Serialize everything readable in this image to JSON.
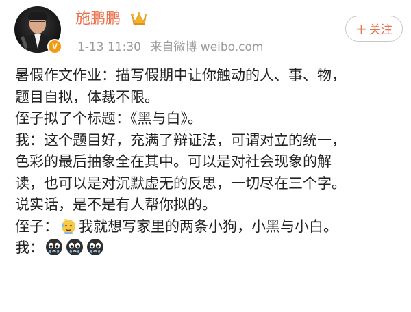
{
  "header": {
    "user_name": "施鹏鹏",
    "timestamp": "1-13 11:30",
    "source": "来自微博 weibo.com",
    "follow_label": "关注",
    "follow_plus": "+",
    "verified_badge": "V",
    "icons": {
      "vip": "crown-icon",
      "verified": "verified-v-icon"
    }
  },
  "post": {
    "lines": [
      "暑假作文作业：描写假期中让你触动的人、事、物，",
      "题目自拟，体裁不限。",
      "侄子拟了个标题：《黑与白》。",
      "我：这个题目好，充满了辩证法，可谓对立的统一，",
      "色彩的最后抽象全在其中。可以是对社会现象的解",
      "读，也可以是对沉默虚无的反思，一切尽在三个字。",
      "说实话，是不是有人帮你拟的。"
    ],
    "nephew_prefix": "侄子：",
    "nephew_text": "我就想写家里的两条小狗，小黑与小白。",
    "me_prefix": "我：",
    "emojis": {
      "nephew": "sweat-emoji",
      "me": [
        "crying-face-emoji",
        "crying-face-emoji",
        "crying-face-emoji"
      ]
    }
  },
  "colors": {
    "name": "#eb7350",
    "meta": "#9a9a9a",
    "text": "#222222",
    "verified": "#f39c12"
  }
}
